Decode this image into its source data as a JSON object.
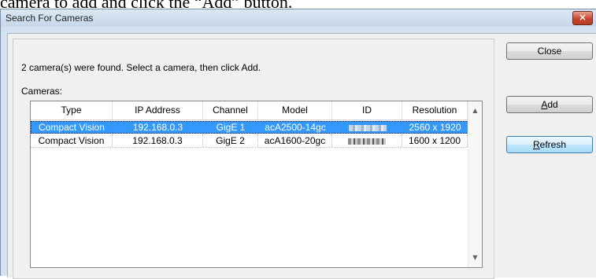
{
  "caption": "camera to add and click the “Add” button.",
  "window": {
    "title": "Search For Cameras",
    "close_glyph": "×"
  },
  "status_text": "2 camera(s) were found.  Select a camera, then click Add.",
  "cameras_label": "Cameras:",
  "table": {
    "columns": [
      "Type",
      "IP Address",
      "Channel",
      "Model",
      "ID",
      "Resolution"
    ],
    "rows": [
      {
        "type": "Compact Vision",
        "ip": "192.168.0.3",
        "channel": "GigE 1",
        "model": "acA2500-14gc",
        "id_icon": "redacted-id",
        "resolution": "2560 x 1920",
        "selected": true
      },
      {
        "type": "Compact Vision",
        "ip": "192.168.0.3",
        "channel": "GigE 2",
        "model": "acA1600-20gc",
        "id_icon": "redacted-id",
        "resolution": "1600 x 1200",
        "selected": false
      }
    ]
  },
  "scrollbar": {
    "up_glyph": "▲",
    "down_glyph": "▼"
  },
  "buttons": {
    "close": "Close",
    "add_mnemonic": "A",
    "add_rest": "dd",
    "refresh_mnemonic": "R",
    "refresh_rest": "efresh"
  }
}
